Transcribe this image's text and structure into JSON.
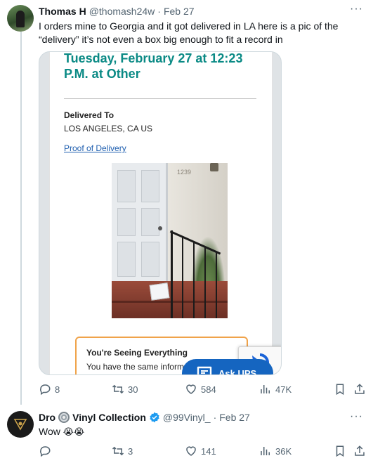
{
  "tweets": [
    {
      "name": "Thomas H",
      "handle": "@thomash24w",
      "date": "Feb 27",
      "text": "I orders mine to Georgia and it got delivered in LA here is a pic of the “delivery” it’s not even a box big enough to fit a record in",
      "stats": {
        "replies": "8",
        "retweets": "30",
        "likes": "584",
        "views": "47K"
      }
    },
    {
      "name_part1": "Dro",
      "name_part2": "Vinyl Collection",
      "handle": "@99Vinyl_",
      "date": "Feb 27",
      "text": "Wow",
      "emoji": "😭😭",
      "stats": {
        "replies": "",
        "retweets": "3",
        "likes": "141",
        "views": "36K"
      }
    }
  ],
  "separator": "·",
  "more": "···",
  "media": {
    "delivery_date": "Tuesday, February 27 at 12:23 P.M. at Other",
    "delivered_to_label": "Delivered To",
    "delivered_to_city": "LOS ANGELES, CA US",
    "proof_link": "Proof of Delivery",
    "house_number": "1239",
    "info_title": "You're Seeing Everything",
    "info_body": "You have the same informat",
    "ask_button": "Ask UPS"
  },
  "colors": {
    "accent": "#1d9bf0",
    "ups_teal": "#0a8a85",
    "ups_blue": "#1565c0",
    "muted": "#536471"
  },
  "icons": [
    "reply-icon",
    "retweet-icon",
    "like-icon",
    "views-icon",
    "bookmark-icon",
    "share-icon",
    "verified-icon",
    "vinyl-disc-icon",
    "chat-icon",
    "recaptcha-icon"
  ]
}
